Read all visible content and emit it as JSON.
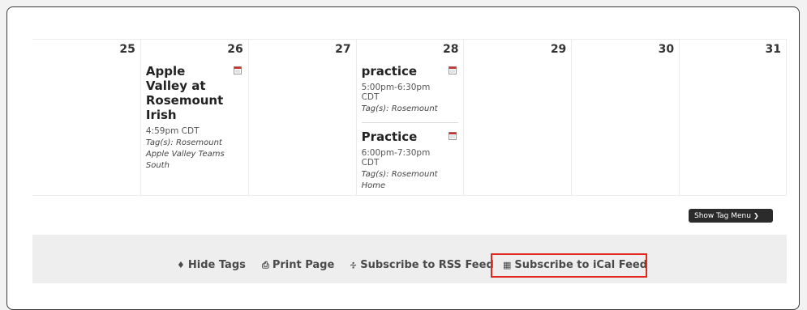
{
  "calendar": {
    "days": [
      {
        "num": "25",
        "events": []
      },
      {
        "num": "26",
        "events": [
          {
            "title": "Apple Valley at Rosemount Irish",
            "time": "4:59pm CDT",
            "tags_label": "Tag(s):",
            "tags": "Rosemount Apple Valley Teams South"
          }
        ]
      },
      {
        "num": "27",
        "events": []
      },
      {
        "num": "28",
        "events": [
          {
            "title": "practice",
            "time": "5:00pm-6:30pm CDT",
            "tags_label": "Tag(s):",
            "tags": "Rosemount"
          },
          {
            "title": "Practice",
            "time": "6:00pm-7:30pm CDT",
            "tags_label": "Tag(s):",
            "tags": "Rosemount Home"
          }
        ]
      },
      {
        "num": "29",
        "events": []
      },
      {
        "num": "30",
        "events": []
      },
      {
        "num": "31",
        "events": []
      }
    ]
  },
  "tag_menu": {
    "label": "Show Tag Menu",
    "icon": "chevron-down-icon"
  },
  "footer": {
    "hide_tags": "Hide Tags",
    "print_page": "Print Page",
    "rss_feed": "Subscribe to RSS Feed",
    "ical_feed": "Subscribe to iCal Feed"
  },
  "colors": {
    "highlight": "#e0281e",
    "footer_bg": "#eeeeee",
    "button_bg": "#2b2b2b"
  }
}
